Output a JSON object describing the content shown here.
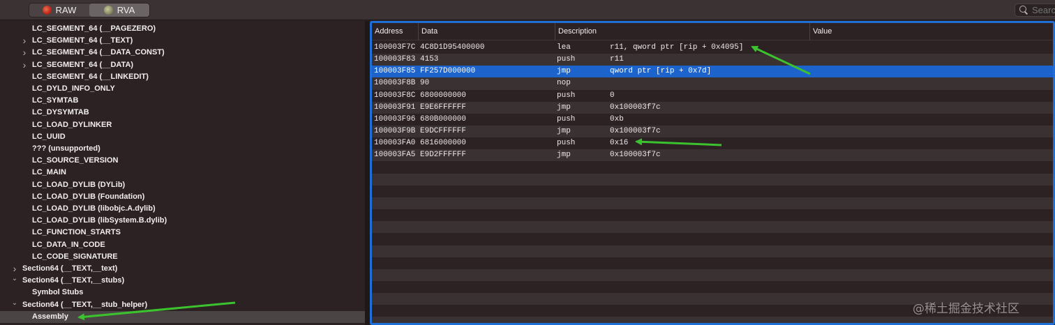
{
  "toolbar": {
    "tabs": [
      {
        "label": "RAW",
        "icon": "raw-icon",
        "selected": false
      },
      {
        "label": "RVA",
        "icon": "rva-icon",
        "selected": true
      }
    ],
    "search": {
      "placeholder": "Search"
    }
  },
  "tree": {
    "items": [
      {
        "label": "LC_SEGMENT_64 (__PAGEZERO)",
        "indent": 2,
        "chevron": ""
      },
      {
        "label": "LC_SEGMENT_64 (__TEXT)",
        "indent": 2,
        "chevron": ">"
      },
      {
        "label": "LC_SEGMENT_64 (__DATA_CONST)",
        "indent": 2,
        "chevron": ">"
      },
      {
        "label": "LC_SEGMENT_64 (__DATA)",
        "indent": 2,
        "chevron": ">"
      },
      {
        "label": "LC_SEGMENT_64 (__LINKEDIT)",
        "indent": 2,
        "chevron": ""
      },
      {
        "label": "LC_DYLD_INFO_ONLY",
        "indent": 2,
        "chevron": ""
      },
      {
        "label": "LC_SYMTAB",
        "indent": 2,
        "chevron": ""
      },
      {
        "label": "LC_DYSYMTAB",
        "indent": 2,
        "chevron": ""
      },
      {
        "label": "LC_LOAD_DYLINKER",
        "indent": 2,
        "chevron": ""
      },
      {
        "label": "LC_UUID",
        "indent": 2,
        "chevron": ""
      },
      {
        "label": "??? (unsupported)",
        "indent": 2,
        "chevron": ""
      },
      {
        "label": "LC_SOURCE_VERSION",
        "indent": 2,
        "chevron": ""
      },
      {
        "label": "LC_MAIN",
        "indent": 2,
        "chevron": ""
      },
      {
        "label": "LC_LOAD_DYLIB (DYLib)",
        "indent": 2,
        "chevron": ""
      },
      {
        "label": "LC_LOAD_DYLIB (Foundation)",
        "indent": 2,
        "chevron": ""
      },
      {
        "label": "LC_LOAD_DYLIB (libobjc.A.dylib)",
        "indent": 2,
        "chevron": ""
      },
      {
        "label": "LC_LOAD_DYLIB (libSystem.B.dylib)",
        "indent": 2,
        "chevron": ""
      },
      {
        "label": "LC_FUNCTION_STARTS",
        "indent": 2,
        "chevron": ""
      },
      {
        "label": "LC_DATA_IN_CODE",
        "indent": 2,
        "chevron": ""
      },
      {
        "label": "LC_CODE_SIGNATURE",
        "indent": 2,
        "chevron": ""
      },
      {
        "label": "Section64 (__TEXT,__text)",
        "indent": 1,
        "chevron": ">"
      },
      {
        "label": "Section64 (__TEXT,__stubs)",
        "indent": 1,
        "chevron": "v"
      },
      {
        "label": "Symbol Stubs",
        "indent": 2,
        "chevron": ""
      },
      {
        "label": "Section64 (__TEXT,__stub_helper)",
        "indent": 1,
        "chevron": "v"
      },
      {
        "label": "Assembly",
        "indent": 2,
        "chevron": "",
        "selected": true
      }
    ]
  },
  "table": {
    "columns": [
      "Address",
      "Data",
      "Description",
      "Value"
    ],
    "rows": [
      {
        "address": "100003F7C",
        "data": "4C8D1D95400000",
        "mnemonic": "lea",
        "operands": "r11, qword ptr [rip + 0x4095]",
        "value": ""
      },
      {
        "address": "100003F83",
        "data": "4153",
        "mnemonic": "push",
        "operands": "r11",
        "value": ""
      },
      {
        "address": "100003F85",
        "data": "FF257D000000",
        "mnemonic": "jmp",
        "operands": "qword ptr [rip + 0x7d]",
        "value": "",
        "selected": true
      },
      {
        "address": "100003F8B",
        "data": "90",
        "mnemonic": "nop",
        "operands": "",
        "value": ""
      },
      {
        "address": "100003F8C",
        "data": "6800000000",
        "mnemonic": "push",
        "operands": "0",
        "value": ""
      },
      {
        "address": "100003F91",
        "data": "E9E6FFFFFF",
        "mnemonic": "jmp",
        "operands": "0x100003f7c",
        "value": ""
      },
      {
        "address": "100003F96",
        "data": "680B000000",
        "mnemonic": "push",
        "operands": "0xb",
        "value": ""
      },
      {
        "address": "100003F9B",
        "data": "E9DCFFFFFF",
        "mnemonic": "jmp",
        "operands": "0x100003f7c",
        "value": ""
      },
      {
        "address": "100003FA0",
        "data": "6816000000",
        "mnemonic": "push",
        "operands": "0x16",
        "value": ""
      },
      {
        "address": "100003FA5",
        "data": "E9D2FFFFFF",
        "mnemonic": "jmp",
        "operands": "0x100003f7c",
        "value": ""
      }
    ]
  },
  "watermark": "@稀土掘金技术社区",
  "colors": {
    "selection": "#1c64cc",
    "focus_ring": "#1f6fd6",
    "annotation_arrow": "#3cc22e",
    "background": "#2c2223",
    "stripe": "#3a3132"
  }
}
